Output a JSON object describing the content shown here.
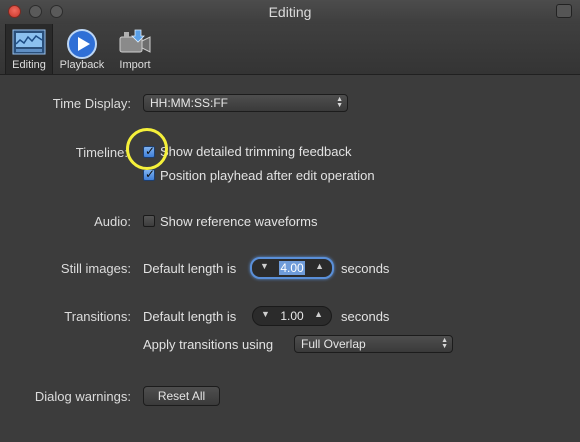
{
  "window": {
    "title": "Editing"
  },
  "toolbar": {
    "items": [
      {
        "label": "Editing",
        "icon": "editing-icon",
        "selected": true
      },
      {
        "label": "Playback",
        "icon": "play-icon"
      },
      {
        "label": "Import",
        "icon": "import-camera-icon"
      }
    ]
  },
  "time_display": {
    "label": "Time Display:",
    "value": "HH:MM:SS:FF"
  },
  "timeline": {
    "label": "Timeline:",
    "options": [
      {
        "label": "Show detailed trimming feedback",
        "checked": true
      },
      {
        "label": "Position playhead after edit operation",
        "checked": true
      }
    ]
  },
  "audio": {
    "label": "Audio:",
    "options": [
      {
        "label": "Show reference waveforms",
        "checked": false
      }
    ]
  },
  "still_images": {
    "label": "Still images:",
    "prefix": "Default length is",
    "value": "4.00",
    "suffix": "seconds"
  },
  "transitions": {
    "label": "Transitions:",
    "prefix": "Default length is",
    "value": "1.00",
    "suffix": "seconds",
    "apply_label": "Apply transitions using",
    "apply_value": "Full Overlap"
  },
  "dialog_warnings": {
    "label": "Dialog warnings:",
    "button": "Reset All"
  },
  "colors": {
    "highlight": "#f5f03a",
    "accent": "#5a8fd8",
    "close": "#e0473b"
  }
}
